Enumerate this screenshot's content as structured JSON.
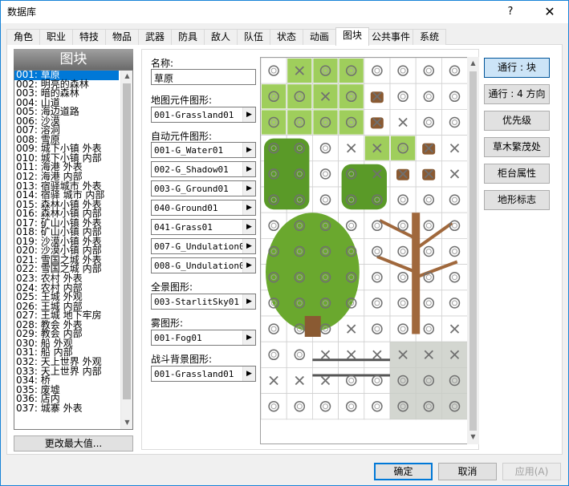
{
  "window": {
    "title": "数据库",
    "help_label": "?",
    "close_label": "✕"
  },
  "tabs": [
    "角色",
    "职业",
    "特技",
    "物品",
    "武器",
    "防具",
    "敌人",
    "队伍",
    "状态",
    "动画",
    "图块",
    "公共事件",
    "系统"
  ],
  "active_tab": "图块",
  "list": {
    "header": "图块",
    "items": [
      "001: 草原",
      "002: 明亮的森林",
      "003: 暗的森林",
      "004: 山道",
      "005: 海边道路",
      "006: 沙漠",
      "007: 溶洞",
      "008: 雪原",
      "009: 城下小镇 外表",
      "010: 城下小镇 内部",
      "011: 海港 外表",
      "012: 海港 内部",
      "013: 宿驿城市 外表",
      "014: 宿驿 城市 内部",
      "015: 森林小镇 外表",
      "016: 森林小镇 内部",
      "017: 矿山小镇 外表",
      "018: 矿山小镇 内部",
      "019: 沙漠小镇 外表",
      "020: 沙漠小镇 内部",
      "021: 雪国之城 外表",
      "022: 雪国之城 内部",
      "023: 农村 外表",
      "024: 农村 内部",
      "025: 王城 外观",
      "026: 王城 内部",
      "027: 王城 地下牢房",
      "028: 教会 外表",
      "029: 教会 内部",
      "030: 船 外观",
      "031: 船 内部",
      "032: 天上世界 外观",
      "033: 天上世界 内部",
      "034: 桥",
      "035: 废墟",
      "036: 店内",
      "037: 城寨 外表"
    ],
    "selected_index": 0,
    "change_max_label": "更改最大值..."
  },
  "form": {
    "name_label": "名称:",
    "name_value": "草原",
    "map_tileset_label": "地图元件图形:",
    "map_tileset_value": "001-Grassland01",
    "autotile_label": "自动元件图形:",
    "autotiles": [
      "001-G_Water01",
      "002-G_Shadow01",
      "003-G_Ground01",
      "040-Ground01",
      "041-Grass01",
      "007-G_Undulation01",
      "008-G_Undulation02"
    ],
    "panorama_label": "全景图形:",
    "panorama_value": "003-StarlitSky01",
    "fog_label": "雾图形:",
    "fog_value": "001-Fog01",
    "battleback_label": "战斗背景图形:",
    "battleback_value": "001-Grassland01",
    "arrow_glyph": "▶"
  },
  "side_buttons": [
    {
      "label": "通行 : 块",
      "pressed": true
    },
    {
      "label": "通行 : 4 方向",
      "pressed": false
    },
    {
      "label": "优先级",
      "pressed": false
    },
    {
      "label": "草木繁茂处",
      "pressed": false
    },
    {
      "label": "柜台属性",
      "pressed": false
    },
    {
      "label": "地形标志",
      "pressed": false
    }
  ],
  "bottom": {
    "ok_label": "确定",
    "cancel_label": "取消",
    "apply_label": "应用(A)"
  },
  "tilemap": {
    "cols": 8,
    "rows": 14,
    "marks": [
      "oxoooooo",
      "ooxoxooo",
      "ooooxxoo",
      "oooxxoxx",
      "ooooxxxx",
      "oooooooo",
      "oooooooo",
      "oooooooo",
      "oooooooo",
      "oooooooo",
      "oooxooox",
      "ooxxxxxx",
      "xxxooooo",
      "oooooooo"
    ],
    "colors": {
      "grass": "#8ec63f",
      "grass_dark": "#5a9a28",
      "tree_leaf": "#6aa82e",
      "trunk": "#8a5a32",
      "dead_tree": "#a0683c",
      "fence": "#555555",
      "stone": "#c8ccc4"
    }
  }
}
